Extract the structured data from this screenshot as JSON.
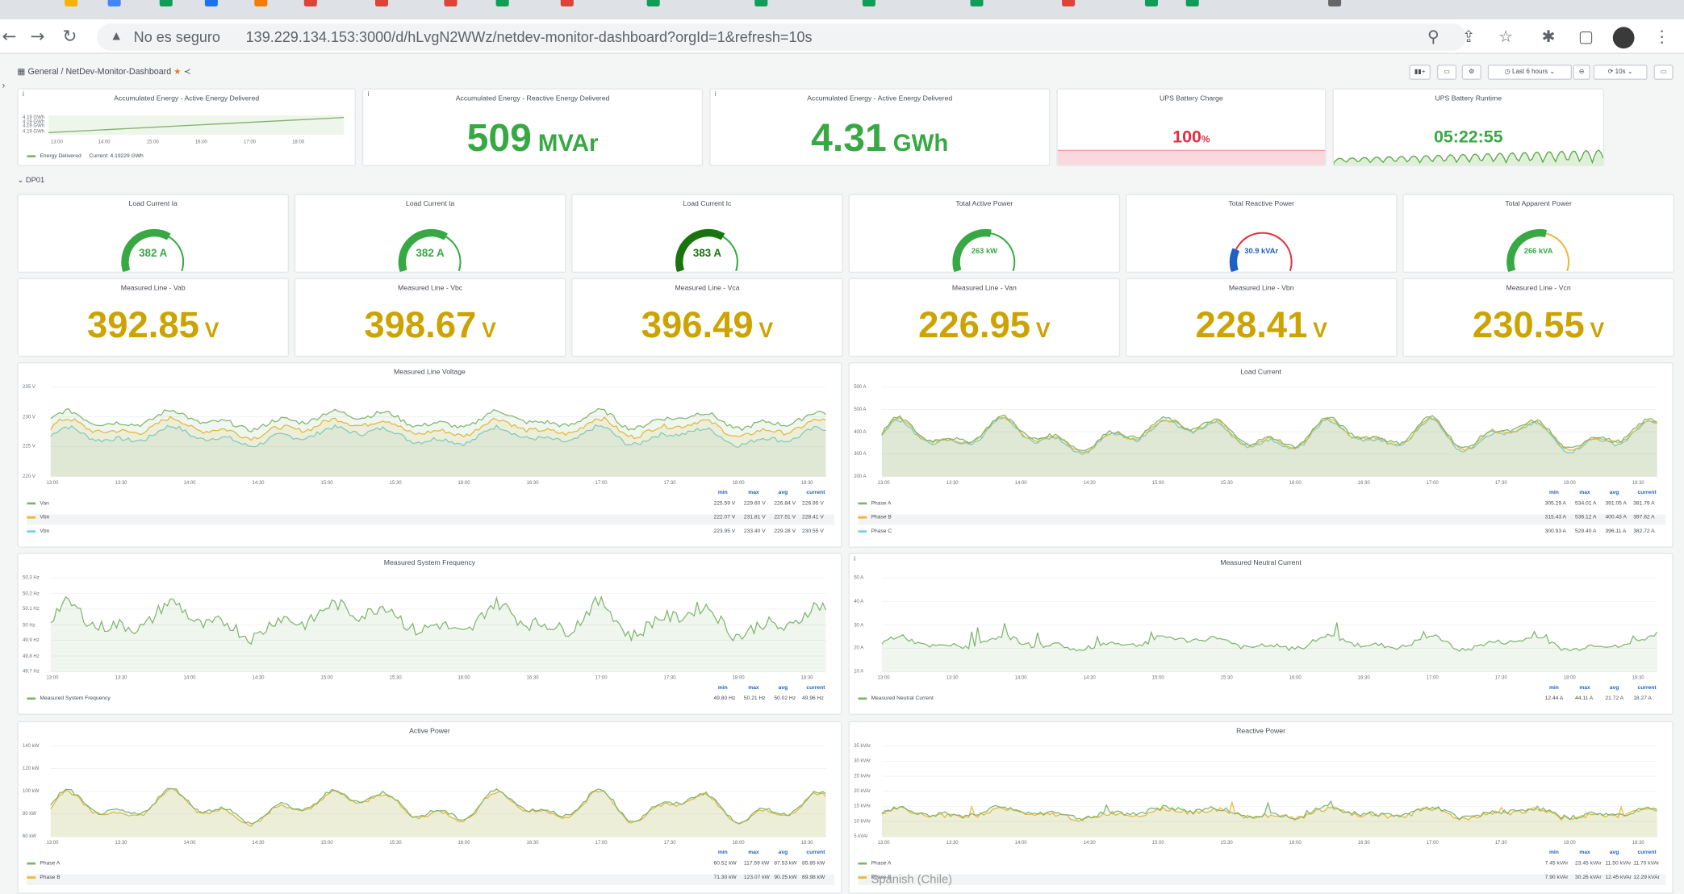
{
  "browser": {
    "warning_label": "No es seguro",
    "url": "139.229.134.153:3000/d/hLvgN2WWz/netdev-monitor-dashboard?orgId=1&refresh=10s"
  },
  "grafana": {
    "breadcrumb_folder": "General",
    "breadcrumb_dashboard": "NetDev-Monitor-Dashboard",
    "time_range": "Last 6 hours",
    "refresh": "10s"
  },
  "top_panels": {
    "energy_graph": {
      "title": "Accumulated Energy - Active Energy Delivered",
      "y_ticks": [
        "4.19 GWh",
        "4.19 GWh",
        "4.19 GWh",
        "4.19 GWh"
      ],
      "x_ticks": [
        "13:00",
        "14:00",
        "15:00",
        "16:00",
        "17:00",
        "18:00"
      ],
      "legend_series": "Energy Delivered",
      "legend_current": "Current: 4.19229 GWh"
    },
    "reactive_stat": {
      "title": "Accumulated Energy - Reactive Energy Delivered",
      "value": "509",
      "unit": "MVAr"
    },
    "active_stat": {
      "title": "Accumulated Energy - Active Energy Delivered",
      "value": "4.31",
      "unit": "GWh"
    },
    "ups_charge": {
      "title": "UPS Battery Charge",
      "value": "100",
      "unit": "%"
    },
    "ups_runtime": {
      "title": "UPS Battery Runtime",
      "value": "05:22:55"
    }
  },
  "row_label": "DP01",
  "gauges": [
    {
      "title": "Load Current Ia",
      "value": "382 A",
      "level": 0.64,
      "color": "#37a843"
    },
    {
      "title": "Load Current Ia",
      "value": "382 A",
      "level": 0.64,
      "color": "#37a843"
    },
    {
      "title": "Load Current Ic",
      "value": "383 A",
      "level": 0.64,
      "color": "#19730e"
    },
    {
      "title": "Total Active Power",
      "value": "263 kW",
      "level": 0.55,
      "color": "#37a843"
    },
    {
      "title": "Total Reactive Power",
      "value": "30.9 kVAr",
      "level": 0.2,
      "color": "#1f60c4"
    },
    {
      "title": "Total Apparent Power",
      "value": "266 kVA",
      "level": 0.56,
      "color": "#37a843"
    }
  ],
  "voltages": [
    {
      "title": "Measured Line - Vab",
      "value": "392.85",
      "unit": "V"
    },
    {
      "title": "Measured Line - Vbc",
      "value": "398.67",
      "unit": "V"
    },
    {
      "title": "Measured Line - Vca",
      "value": "396.49",
      "unit": "V"
    },
    {
      "title": "Measured Line - Van",
      "value": "226.95",
      "unit": "V"
    },
    {
      "title": "Measured Line - Vbn",
      "value": "228.41",
      "unit": "V"
    },
    {
      "title": "Measured Line - Vcn",
      "value": "230.55",
      "unit": "V"
    }
  ],
  "legend_headers": {
    "min": "min",
    "max": "max",
    "avg": "avg",
    "current": "current"
  },
  "charts": {
    "line_voltage": {
      "title": "Measured Line Voltage",
      "y_ticks": [
        "235 V",
        "230 V",
        "225 V",
        "220 V"
      ],
      "x_ticks": [
        "13:00",
        "13:30",
        "14:00",
        "14:30",
        "15:00",
        "15:30",
        "16:00",
        "16:30",
        "17:00",
        "17:30",
        "18:00",
        "18:30"
      ],
      "series": [
        {
          "name": "Van",
          "color": "#7eb26d",
          "min": "225.59 V",
          "max": "229.60 V",
          "avg": "226.84 V",
          "current": "226.95 V"
        },
        {
          "name": "Vbn",
          "color": "#eab839",
          "min": "222.07 V",
          "max": "231.81 V",
          "avg": "227.51 V",
          "current": "228.41 V"
        },
        {
          "name": "Vbn",
          "color": "#6ed0e0",
          "min": "223.95 V",
          "max": "233.40 V",
          "avg": "229.28 V",
          "current": "230.55 V"
        }
      ]
    },
    "load_current": {
      "title": "Load Current",
      "y_ticks": [
        "500 A",
        "500 A",
        "400 A",
        "300 A",
        "200 A"
      ],
      "x_ticks": [
        "13:00",
        "13:30",
        "14:00",
        "14:30",
        "15:00",
        "15:30",
        "16:00",
        "16:30",
        "17:00",
        "17:30",
        "18:00",
        "18:30"
      ],
      "series": [
        {
          "name": "Phase A",
          "color": "#7eb26d",
          "min": "305.29 A",
          "max": "534.01 A",
          "avg": "391.05 A",
          "current": "381.79 A"
        },
        {
          "name": "Phase B",
          "color": "#eab839",
          "min": "315.43 A",
          "max": "536.12 A",
          "avg": "400.43 A",
          "current": "397.62 A"
        },
        {
          "name": "Phase C",
          "color": "#6ed0e0",
          "min": "300.93 A",
          "max": "529.40 A",
          "avg": "396.11 A",
          "current": "382.72 A"
        }
      ]
    },
    "frequency": {
      "title": "Measured System Frequency",
      "y_ticks": [
        "50.3 Hz",
        "50.2 Hz",
        "50.1 Hz",
        "50 Hz",
        "49.9 Hz",
        "49.8 Hz",
        "49.7 Hz"
      ],
      "x_ticks": [
        "13:00",
        "13:30",
        "14:00",
        "14:30",
        "15:00",
        "15:30",
        "16:00",
        "16:30",
        "17:00",
        "17:30",
        "18:00",
        "18:30"
      ],
      "series": [
        {
          "name": "Measured System Frequency",
          "color": "#7eb26d",
          "min": "49.80 Hz",
          "max": "50.21 Hz",
          "avg": "50.02 Hz",
          "current": "49.96 Hz"
        }
      ]
    },
    "neutral_current": {
      "title": "Measured Neutral Current",
      "y_ticks": [
        "50 A",
        "40 A",
        "30 A",
        "20 A",
        "10 A"
      ],
      "x_ticks": [
        "13:00",
        "13:30",
        "14:00",
        "14:30",
        "15:00",
        "15:30",
        "16:00",
        "16:30",
        "17:00",
        "17:30",
        "18:00",
        "18:30"
      ],
      "series": [
        {
          "name": "Measured Neutral Current",
          "color": "#7eb26d",
          "min": "12.44 A",
          "max": "44.11 A",
          "avg": "21.72 A",
          "current": "18.27 A"
        }
      ]
    },
    "active_power": {
      "title": "Active Power",
      "y_ticks": [
        "140 kW",
        "120 kW",
        "100 kW",
        "80 kW",
        "60 kW"
      ],
      "x_ticks": [
        "13:00",
        "13:30",
        "14:00",
        "14:30",
        "15:00",
        "15:30",
        "16:00",
        "16:30",
        "17:00",
        "17:30",
        "18:00",
        "18:30"
      ],
      "series": [
        {
          "name": "Phase A",
          "color": "#7eb26d",
          "min": "60.52 kW",
          "max": "117.59 kW",
          "avg": "87.53 kW",
          "current": "85.85 kW"
        },
        {
          "name": "Phase B",
          "color": "#eab839",
          "min": "71.30 kW",
          "max": "123.07 kW",
          "avg": "90.25 kW",
          "current": "89.98 kW"
        }
      ]
    },
    "reactive_power": {
      "title": "Reactive Power",
      "y_ticks": [
        "35 kVAr",
        "30 kVAr",
        "25 kVAr",
        "20 kVAr",
        "15 kVAr",
        "10 kVAr",
        "5 kVAr"
      ],
      "x_ticks": [
        "13:00",
        "13:30",
        "14:00",
        "14:30",
        "15:00",
        "15:30",
        "16:00",
        "16:30",
        "17:00",
        "17:30",
        "18:00",
        "18:30"
      ],
      "series": [
        {
          "name": "Phase A",
          "color": "#7eb26d",
          "min": "7.45 kVAr",
          "max": "23.45 kVAr",
          "avg": "11.50 kVAr",
          "current": "11.70 kVAr"
        },
        {
          "name": "Phase B",
          "color": "#eab839",
          "min": "7.90 kVAr",
          "max": "30.26 kVAr",
          "avg": "12.45 kVAr",
          "current": "12.29 kVAr"
        }
      ]
    }
  },
  "overlay_hint": "Spanish (Chile)"
}
